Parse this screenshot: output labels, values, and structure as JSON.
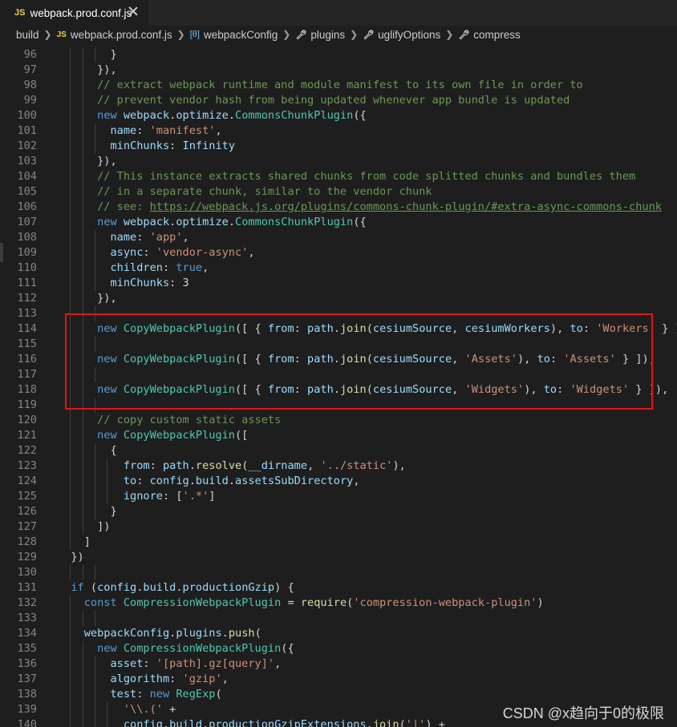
{
  "tab": {
    "icon": "JS",
    "title": "webpack.prod.conf.js",
    "close_icon": "close-icon"
  },
  "breadcrumb": {
    "items": [
      {
        "label": "build",
        "icon": ""
      },
      {
        "label": "webpack.prod.conf.js",
        "icon": "JS"
      },
      {
        "label": "webpackConfig",
        "icon": "[θ]"
      },
      {
        "label": "plugins",
        "icon": "wrench-icon"
      },
      {
        "label": "uglifyOptions",
        "icon": "wrench-icon"
      },
      {
        "label": "compress",
        "icon": "wrench-icon"
      }
    ]
  },
  "editor": {
    "lines": [
      {
        "n": "96",
        "tokens": [
          [
            "",
            "        }"
          ]
        ]
      },
      {
        "n": "97",
        "tokens": [
          [
            "",
            "      }),"
          ]
        ]
      },
      {
        "n": "98",
        "tokens": [
          [
            "c",
            "      // extract webpack runtime and module manifest to its own file in order to"
          ]
        ]
      },
      {
        "n": "99",
        "tokens": [
          [
            "c",
            "      // prevent vendor hash from being updated whenever app bundle is updated"
          ]
        ]
      },
      {
        "n": "100",
        "tokens": [
          [
            "",
            "      "
          ],
          [
            "k",
            "new"
          ],
          [
            "",
            " "
          ],
          [
            "p",
            "webpack"
          ],
          [
            "",
            "."
          ],
          [
            "p",
            "optimize"
          ],
          [
            "",
            "."
          ],
          [
            "t",
            "CommonsChunkPlugin"
          ],
          [
            "",
            "({"
          ]
        ]
      },
      {
        "n": "101",
        "tokens": [
          [
            "",
            "        "
          ],
          [
            "p",
            "name"
          ],
          [
            "",
            ": "
          ],
          [
            "s",
            "'manifest'"
          ],
          [
            "",
            ","
          ]
        ]
      },
      {
        "n": "102",
        "tokens": [
          [
            "",
            "        "
          ],
          [
            "p",
            "minChunks"
          ],
          [
            "",
            ": "
          ],
          [
            "p",
            "Infinity"
          ]
        ]
      },
      {
        "n": "103",
        "tokens": [
          [
            "",
            "      }),"
          ]
        ]
      },
      {
        "n": "104",
        "tokens": [
          [
            "c",
            "      // This instance extracts shared chunks from code splitted chunks and bundles them"
          ]
        ]
      },
      {
        "n": "105",
        "tokens": [
          [
            "c",
            "      // in a separate chunk, similar to the vendor chunk"
          ]
        ]
      },
      {
        "n": "106",
        "tokens": [
          [
            "c",
            "      // see: "
          ],
          [
            "l",
            "https://webpack.js.org/plugins/commons-chunk-plugin/#extra-async-commons-chunk"
          ]
        ]
      },
      {
        "n": "107",
        "tokens": [
          [
            "",
            "      "
          ],
          [
            "k",
            "new"
          ],
          [
            "",
            " "
          ],
          [
            "p",
            "webpack"
          ],
          [
            "",
            "."
          ],
          [
            "p",
            "optimize"
          ],
          [
            "",
            "."
          ],
          [
            "t",
            "CommonsChunkPlugin"
          ],
          [
            "",
            "({"
          ]
        ]
      },
      {
        "n": "108",
        "tokens": [
          [
            "",
            "        "
          ],
          [
            "p",
            "name"
          ],
          [
            "",
            ": "
          ],
          [
            "s",
            "'app'"
          ],
          [
            "",
            ","
          ]
        ]
      },
      {
        "n": "109",
        "tokens": [
          [
            "",
            "        "
          ],
          [
            "p",
            "async"
          ],
          [
            "",
            ": "
          ],
          [
            "s",
            "'vendor-async'"
          ],
          [
            "",
            ","
          ]
        ]
      },
      {
        "n": "110",
        "tokens": [
          [
            "",
            "        "
          ],
          [
            "p",
            "children"
          ],
          [
            "",
            ": "
          ],
          [
            "k",
            "true"
          ],
          [
            "",
            ","
          ]
        ]
      },
      {
        "n": "111",
        "tokens": [
          [
            "",
            "        "
          ],
          [
            "p",
            "minChunks"
          ],
          [
            "",
            ": "
          ],
          [
            "",
            "3"
          ]
        ]
      },
      {
        "n": "112",
        "tokens": [
          [
            "",
            "      }),"
          ]
        ]
      },
      {
        "n": "113",
        "tokens": []
      },
      {
        "n": "114",
        "tokens": [
          [
            "",
            "      "
          ],
          [
            "k",
            "new"
          ],
          [
            "",
            " "
          ],
          [
            "t",
            "CopyWebpackPlugin"
          ],
          [
            "",
            "([ { "
          ],
          [
            "p",
            "from"
          ],
          [
            "",
            ": "
          ],
          [
            "p",
            "path"
          ],
          [
            "",
            "."
          ],
          [
            "f",
            "join"
          ],
          [
            "",
            "("
          ],
          [
            "p",
            "cesiumSource"
          ],
          [
            "",
            ", "
          ],
          [
            "p",
            "cesiumWorkers"
          ],
          [
            "",
            "), "
          ],
          [
            "p",
            "to"
          ],
          [
            "",
            ": "
          ],
          [
            "s",
            "'Workers'"
          ],
          [
            "",
            " } ]),"
          ]
        ]
      },
      {
        "n": "115",
        "tokens": []
      },
      {
        "n": "116",
        "tokens": [
          [
            "",
            "      "
          ],
          [
            "k",
            "new"
          ],
          [
            "",
            " "
          ],
          [
            "t",
            "CopyWebpackPlugin"
          ],
          [
            "",
            "([ { "
          ],
          [
            "p",
            "from"
          ],
          [
            "",
            ": "
          ],
          [
            "p",
            "path"
          ],
          [
            "",
            "."
          ],
          [
            "f",
            "join"
          ],
          [
            "",
            "("
          ],
          [
            "p",
            "cesiumSource"
          ],
          [
            "",
            ", "
          ],
          [
            "s",
            "'Assets'"
          ],
          [
            "",
            "), "
          ],
          [
            "p",
            "to"
          ],
          [
            "",
            ": "
          ],
          [
            "s",
            "'Assets'"
          ],
          [
            "",
            " } ]),"
          ]
        ]
      },
      {
        "n": "117",
        "tokens": []
      },
      {
        "n": "118",
        "tokens": [
          [
            "",
            "      "
          ],
          [
            "k",
            "new"
          ],
          [
            "",
            " "
          ],
          [
            "t",
            "CopyWebpackPlugin"
          ],
          [
            "",
            "([ { "
          ],
          [
            "p",
            "from"
          ],
          [
            "",
            ": "
          ],
          [
            "p",
            "path"
          ],
          [
            "",
            "."
          ],
          [
            "f",
            "join"
          ],
          [
            "",
            "("
          ],
          [
            "p",
            "cesiumSource"
          ],
          [
            "",
            ", "
          ],
          [
            "s",
            "'Widgets'"
          ],
          [
            "",
            "), "
          ],
          [
            "p",
            "to"
          ],
          [
            "",
            ": "
          ],
          [
            "s",
            "'Widgets'"
          ],
          [
            "",
            " } ]),"
          ]
        ]
      },
      {
        "n": "119",
        "tokens": []
      },
      {
        "n": "120",
        "tokens": [
          [
            "c",
            "      // copy custom static assets"
          ]
        ]
      },
      {
        "n": "121",
        "tokens": [
          [
            "",
            "      "
          ],
          [
            "k",
            "new"
          ],
          [
            "",
            " "
          ],
          [
            "t",
            "CopyWebpackPlugin"
          ],
          [
            "",
            "(["
          ]
        ]
      },
      {
        "n": "122",
        "tokens": [
          [
            "",
            "        {"
          ]
        ]
      },
      {
        "n": "123",
        "tokens": [
          [
            "",
            "          "
          ],
          [
            "p",
            "from"
          ],
          [
            "",
            ": "
          ],
          [
            "p",
            "path"
          ],
          [
            "",
            "."
          ],
          [
            "f",
            "resolve"
          ],
          [
            "",
            "("
          ],
          [
            "p",
            "__dirname"
          ],
          [
            "",
            ", "
          ],
          [
            "s",
            "'../static'"
          ],
          [
            "",
            "),"
          ]
        ]
      },
      {
        "n": "124",
        "tokens": [
          [
            "",
            "          "
          ],
          [
            "p",
            "to"
          ],
          [
            "",
            ": "
          ],
          [
            "p",
            "config"
          ],
          [
            "",
            "."
          ],
          [
            "p",
            "build"
          ],
          [
            "",
            "."
          ],
          [
            "p",
            "assetsSubDirectory"
          ],
          [
            "",
            ","
          ]
        ]
      },
      {
        "n": "125",
        "tokens": [
          [
            "",
            "          "
          ],
          [
            "p",
            "ignore"
          ],
          [
            "",
            ": ["
          ],
          [
            "s",
            "'.*'"
          ],
          [
            "",
            "]"
          ]
        ]
      },
      {
        "n": "126",
        "tokens": [
          [
            "",
            "        }"
          ]
        ]
      },
      {
        "n": "127",
        "tokens": [
          [
            "",
            "      ])"
          ]
        ]
      },
      {
        "n": "128",
        "tokens": [
          [
            "",
            "    ]"
          ]
        ]
      },
      {
        "n": "129",
        "tokens": [
          [
            "",
            "  })"
          ]
        ]
      },
      {
        "n": "130",
        "tokens": []
      },
      {
        "n": "131",
        "tokens": [
          [
            "",
            "  "
          ],
          [
            "k",
            "if"
          ],
          [
            "",
            " ("
          ],
          [
            "p",
            "config"
          ],
          [
            "",
            "."
          ],
          [
            "p",
            "build"
          ],
          [
            "",
            "."
          ],
          [
            "p",
            "productionGzip"
          ],
          [
            "",
            ") {"
          ]
        ]
      },
      {
        "n": "132",
        "tokens": [
          [
            "",
            "    "
          ],
          [
            "k",
            "const"
          ],
          [
            "",
            " "
          ],
          [
            "t",
            "CompressionWebpackPlugin"
          ],
          [
            "",
            " = "
          ],
          [
            "f",
            "require"
          ],
          [
            "",
            "("
          ],
          [
            "s",
            "'compression-webpack-plugin'"
          ],
          [
            "",
            ")"
          ]
        ]
      },
      {
        "n": "133",
        "tokens": []
      },
      {
        "n": "134",
        "tokens": [
          [
            "",
            "    "
          ],
          [
            "p",
            "webpackConfig"
          ],
          [
            "",
            "."
          ],
          [
            "p",
            "plugins"
          ],
          [
            "",
            "."
          ],
          [
            "f",
            "push"
          ],
          [
            "",
            "("
          ]
        ]
      },
      {
        "n": "135",
        "tokens": [
          [
            "",
            "      "
          ],
          [
            "k",
            "new"
          ],
          [
            "",
            " "
          ],
          [
            "t",
            "CompressionWebpackPlugin"
          ],
          [
            "",
            "({"
          ]
        ]
      },
      {
        "n": "136",
        "tokens": [
          [
            "",
            "        "
          ],
          [
            "p",
            "asset"
          ],
          [
            "",
            ": "
          ],
          [
            "s",
            "'[path].gz[query]'"
          ],
          [
            "",
            ","
          ]
        ]
      },
      {
        "n": "137",
        "tokens": [
          [
            "",
            "        "
          ],
          [
            "p",
            "algorithm"
          ],
          [
            "",
            ": "
          ],
          [
            "s",
            "'gzip'"
          ],
          [
            "",
            ","
          ]
        ]
      },
      {
        "n": "138",
        "tokens": [
          [
            "",
            "        "
          ],
          [
            "p",
            "test"
          ],
          [
            "",
            ": "
          ],
          [
            "k",
            "new"
          ],
          [
            "",
            " "
          ],
          [
            "t",
            "RegExp"
          ],
          [
            "",
            "("
          ]
        ]
      },
      {
        "n": "139",
        "tokens": [
          [
            "",
            "          "
          ],
          [
            "s",
            "'\\\\.('"
          ],
          [
            "",
            " +"
          ]
        ]
      },
      {
        "n": "140",
        "tokens": [
          [
            "",
            "          "
          ],
          [
            "p",
            "config"
          ],
          [
            "",
            "."
          ],
          [
            "p",
            "build"
          ],
          [
            "",
            "."
          ],
          [
            "p",
            "productionGzipExtensions"
          ],
          [
            "",
            "."
          ],
          [
            "f",
            "join"
          ],
          [
            "",
            "("
          ],
          [
            "s",
            "'|'"
          ],
          [
            "",
            ") +"
          ]
        ]
      }
    ]
  },
  "watermark": "CSDN @x趋向于0的极限"
}
